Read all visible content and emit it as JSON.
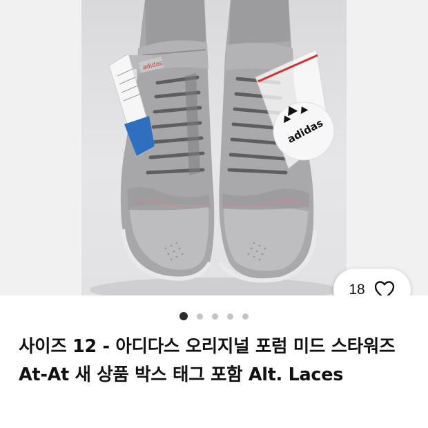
{
  "listing": {
    "title": "사이즈 12 - 아디다스 오리지널 포럼 미드 스타워즈 At-At 새 상품 박스 태그 포함 Alt. Laces",
    "favorites_count": "18",
    "image_count": 5,
    "current_image": 1
  },
  "photo": {
    "tag_brand_text": "adidas",
    "bag_brand_text": "adidas"
  },
  "icons": {
    "favorite": "heart-outline-icon"
  },
  "colors": {
    "title_text": "#111111",
    "dot_active": "#2b2b2b",
    "dot_inactive": "#c4c4c4",
    "gallery_bg": "#f1f1f1"
  }
}
